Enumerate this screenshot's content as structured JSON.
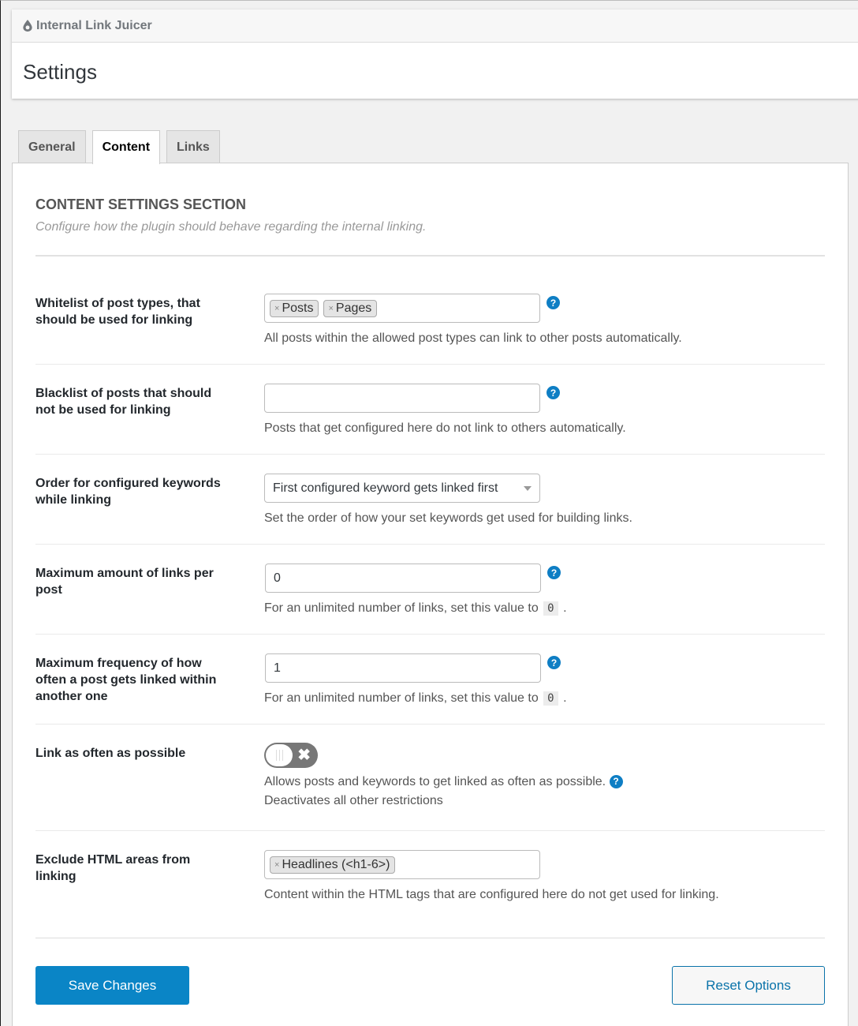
{
  "header": {
    "plugin_name": "Internal Link Juicer",
    "page_title": "Settings"
  },
  "tabs": [
    {
      "label": "General",
      "active": false
    },
    {
      "label": "Content",
      "active": true
    },
    {
      "label": "Links",
      "active": false
    }
  ],
  "section": {
    "title": "CONTENT SETTINGS SECTION",
    "description": "Configure how the plugin should behave regarding the internal linking."
  },
  "settings": {
    "whitelist": {
      "label": "Whitelist of post types, that should be used for linking",
      "tags": [
        "Posts",
        "Pages"
      ],
      "hint": "All posts within the allowed post types can link to other posts automatically."
    },
    "blacklist": {
      "label": "Blacklist of posts that should not be used for linking",
      "value": "",
      "hint": "Posts that get configured here do not link to others automatically."
    },
    "keyword_order": {
      "label": "Order for configured keywords while linking",
      "selected": "First configured keyword gets linked first",
      "hint": "Set the order of how your set keywords get used for building links."
    },
    "max_links": {
      "label": "Maximum amount of links per post",
      "value": "0",
      "hint_prefix": "For an unlimited number of links, set this value to",
      "hint_code": "0",
      "hint_suffix": "."
    },
    "max_frequency": {
      "label": "Maximum frequency of how often a post gets linked within another one",
      "value": "1",
      "hint_prefix": "For an unlimited number of links, set this value to",
      "hint_code": "0",
      "hint_suffix": "."
    },
    "link_often": {
      "label": "Link as often as possible",
      "enabled": false,
      "hint_line1": "Allows posts and keywords to get linked as often as possible.",
      "hint_line2": "Deactivates all other restrictions"
    },
    "exclude_html": {
      "label": "Exclude HTML areas from linking",
      "tags": [
        "Headlines (<h1-6>)"
      ],
      "hint": "Content within the HTML tags that are configured here do not get used for linking."
    }
  },
  "help_glyph": "?",
  "remove_glyph": "×",
  "toggle_off_glyph": "✖",
  "buttons": {
    "save": "Save Changes",
    "reset": "Reset Options"
  },
  "colors": {
    "primary": "#0a85c6",
    "help_icon": "#0e7ec4",
    "toggle_off": "#777777"
  }
}
